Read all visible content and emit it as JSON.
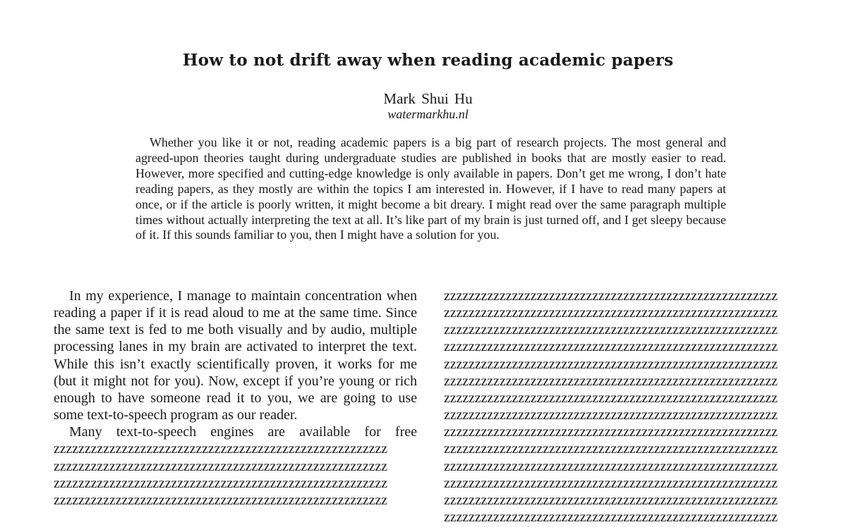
{
  "document": {
    "title": "How to not drift away when reading academic papers",
    "author": "Mark Shui Hu",
    "website": "watermarkhu.nl",
    "abstract": "Whether you like it or not, reading academic papers is a big part of research projects. The most general and agreed-upon theories taught during undergraduate studies are published in books that are mostly easier to read. However, more specified and cutting-edge knowledge is only available in papers. Don’t get me wrong, I don’t hate reading papers, as they mostly are within the topics I am interested in. However, if I have to read many papers at once, or if the article is poorly written, it might become a bit dreary. I might read over the same paragraph multiple times without actually interpreting the text at all. It’s like part of my brain is just turned off, and I get sleepy because of it. If this sounds familiar to you, then I might have a solution for you.",
    "body": {
      "paragraph_1": "In my experience, I manage to maintain concentration when reading a paper if it is read aloud to me at the same time. Since the same text is fed to me both visually and by audio, multiple processing lanes in my brain are activated to interpret the text. While this isn’t exactly scientifically proven, it works for me (but it might not for you). Now, except if you’re young or rich enough to have someone read it to you, we are going to use some text-to-speech program as our reader.",
      "paragraph_2_start": "Many text-to-speech engines are available for free",
      "left_filler_lines": [
        "zzzzzzzzzzzzzzzzzzzzzzzzzzzzzzzzzzzzzzzzzzzzzzzzzzzzzz",
        "zzzzzzzzzzzzzzzzzzzzzzzzzzzzzzzzzzzzzzzzzzzzzzzzzzzzzz",
        "zzzzzzzzzzzzzzzzzzzzzzzzzzzzzzzzzzzzzzzzzzzzzzzzzzzzzz",
        "zzzzzzzzzzzzzzzzzzzzzzzzzzzzzzzzzzzzzzzzzzzzzzzzzzzzzz"
      ],
      "right_filler_lines": [
        "zzzzzzzzzzzzzzzzzzzzzzzzzzzzzzzzzzzzzzzzzzzzzzzzzzzzzz",
        "zzzzzzzzzzzzzzzzzzzzzzzzzzzzzzzzzzzzzzzzzzzzzzzzzzzzzz",
        "zzzzzzzzzzzzzzzzzzzzzzzzzzzzzzzzzzzzzzzzzzzzzzzzzzzzzz",
        "zzzzzzzzzzzzzzzzzzzzzzzzzzzzzzzzzzzzzzzzzzzzzzzzzzzzzz",
        "zzzzzzzzzzzzzzzzzzzzzzzzzzzzzzzzzzzzzzzzzzzzzzzzzzzzzz",
        "zzzzzzzzzzzzzzzzzzzzzzzzzzzzzzzzzzzzzzzzzzzzzzzzzzzzzz",
        "zzzzzzzzzzzzzzzzzzzzzzzzzzzzzzzzzzzzzzzzzzzzzzzzzzzzzz",
        "zzzzzzzzzzzzzzzzzzzzzzzzzzzzzzzzzzzzzzzzzzzzzzzzzzzzzz",
        "zzzzzzzzzzzzzzzzzzzzzzzzzzzzzzzzzzzzzzzzzzzzzzzzzzzzzz",
        "zzzzzzzzzzzzzzzzzzzzzzzzzzzzzzzzzzzzzzzzzzzzzzzzzzzzzz",
        "zzzzzzzzzzzzzzzzzzzzzzzzzzzzzzzzzzzzzzzzzzzzzzzzzzzzzz",
        "zzzzzzzzzzzzzzzzzzzzzzzzzzzzzzzzzzzzzzzzzzzzzzzzzzzzzz",
        "zzzzzzzzzzzzzzzzzzzzzzzzzzzzzzzzzzzzzzzzzzzzzzzzzzzzzz",
        "zzzzzzzzzzzzzzzzzzzzzzzzzzzzzzzzzzzzzzzzzzzzzzzzzzzzzz"
      ]
    }
  }
}
